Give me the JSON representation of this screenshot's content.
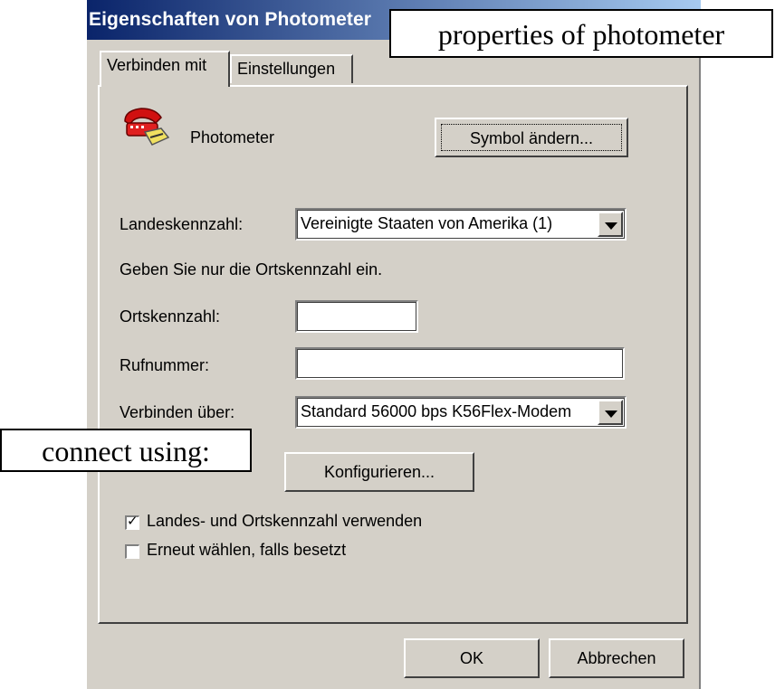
{
  "window": {
    "title": "Eigenschaften von Photometer"
  },
  "annotations": {
    "top_callout": "properties of photometer",
    "left_callout": "connect using:"
  },
  "tabs": [
    {
      "label": "Verbinden mit",
      "active": true
    },
    {
      "label": "Einstellungen",
      "active": false
    }
  ],
  "connection": {
    "icon": "telephone-icon",
    "name": "Photometer",
    "change_icon_button": "Symbol ändern..."
  },
  "country": {
    "label": "Landeskennzahl:",
    "value": "Vereinigte Staaten von Amerika (1)"
  },
  "hint": "Geben Sie nur die Ortskennzahl ein.",
  "area_code": {
    "label": "Ortskennzahl:",
    "value": ""
  },
  "phone": {
    "label": "Rufnummer:",
    "value": ""
  },
  "connect_using": {
    "label": "Verbinden über:",
    "value": "Standard 56000 bps K56Flex-Modem",
    "configure_button": "Konfigurieren..."
  },
  "options": [
    {
      "label": "Landes- und Ortskennzahl verwenden",
      "checked": true
    },
    {
      "label": "Erneut wählen, falls besetzt",
      "checked": false
    }
  ],
  "footer": {
    "ok": "OK",
    "cancel": "Abbrechen"
  },
  "colors": {
    "face": "#d4d0c8",
    "title_start": "#0a246a",
    "title_end": "#a6caf0"
  }
}
